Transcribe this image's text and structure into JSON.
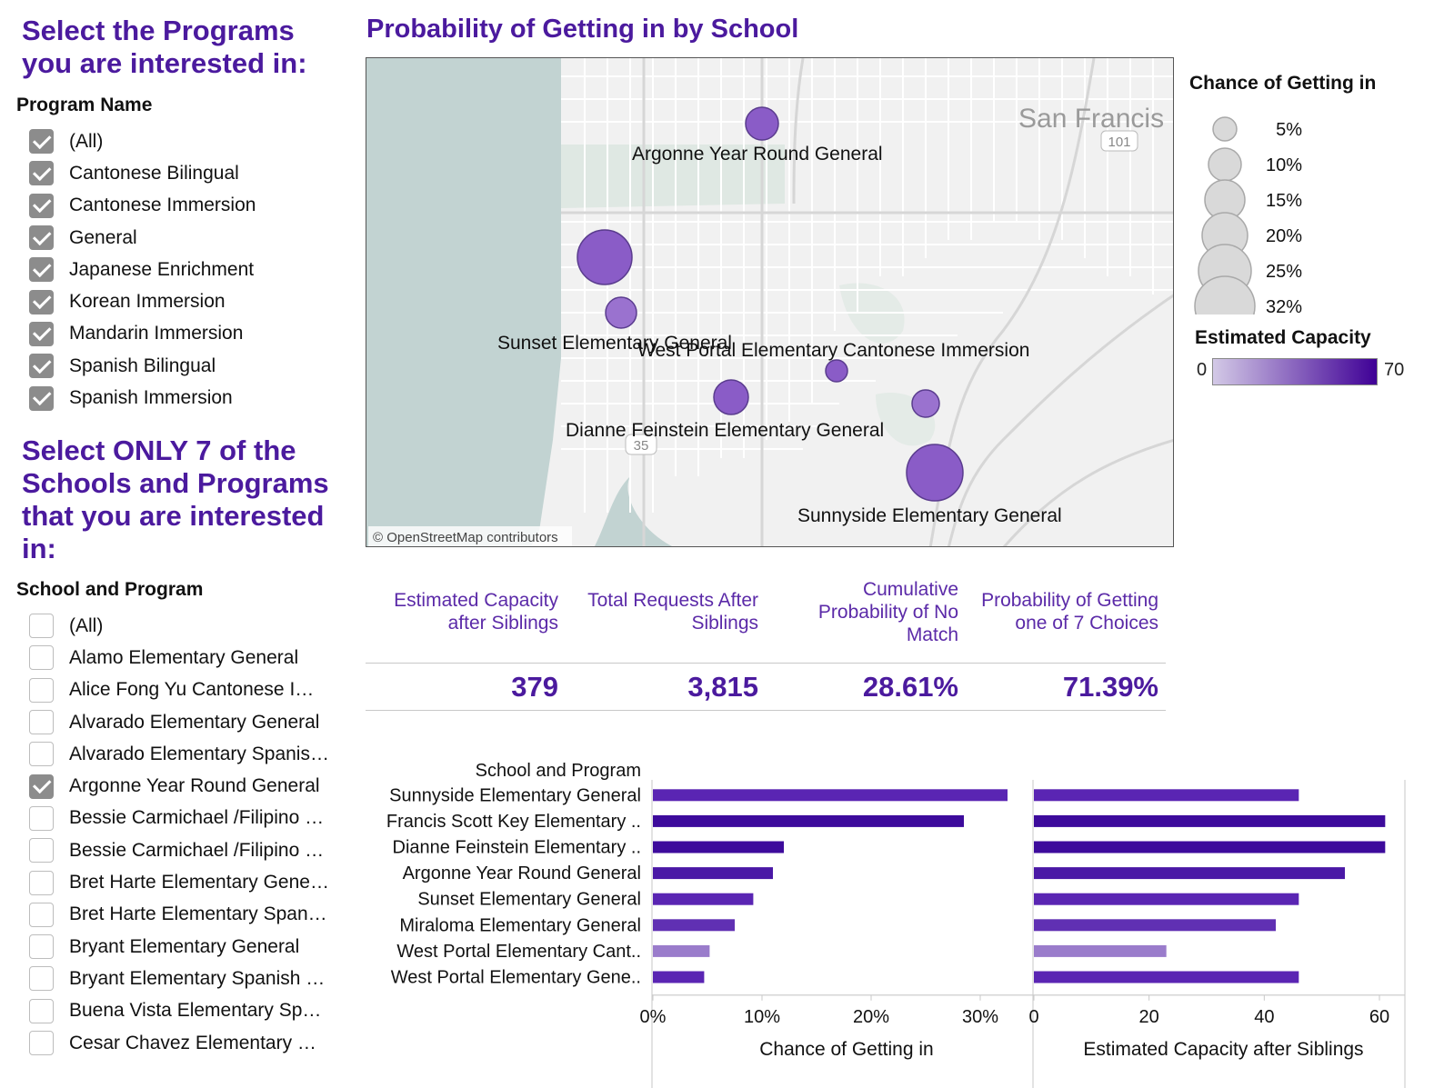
{
  "filters": {
    "programs_title": "Select the Programs you are interested in:",
    "program_field": "Program Name",
    "programs": [
      {
        "label": "(All)",
        "checked": true
      },
      {
        "label": "Cantonese Bilingual",
        "checked": true
      },
      {
        "label": "Cantonese Immersion",
        "checked": true
      },
      {
        "label": "General",
        "checked": true
      },
      {
        "label": "Japanese Enrichment",
        "checked": true
      },
      {
        "label": "Korean Immersion",
        "checked": true
      },
      {
        "label": "Mandarin Immersion",
        "checked": true
      },
      {
        "label": "Spanish Bilingual",
        "checked": true
      },
      {
        "label": "Spanish Immersion",
        "checked": true
      }
    ],
    "schools_title": "Select ONLY 7 of the Schools and Programs that you are interested in:",
    "school_field": "School and Program",
    "schools": [
      {
        "label": "(All)",
        "checked": false
      },
      {
        "label": "Alamo Elementary  General",
        "checked": false
      },
      {
        "label": "Alice Fong Yu  Cantonese I…",
        "checked": false
      },
      {
        "label": "Alvarado Elementary  General",
        "checked": false
      },
      {
        "label": "Alvarado Elementary  Spanis…",
        "checked": false
      },
      {
        "label": "Argonne Year Round  General",
        "checked": true
      },
      {
        "label": "Bessie Carmichael /Filipino …",
        "checked": false
      },
      {
        "label": "Bessie Carmichael /Filipino …",
        "checked": false
      },
      {
        "label": "Bret Harte Elementary  Gene…",
        "checked": false
      },
      {
        "label": "Bret Harte Elementary  Span…",
        "checked": false
      },
      {
        "label": "Bryant Elementary  General",
        "checked": false
      },
      {
        "label": "Bryant Elementary  Spanish …",
        "checked": false
      },
      {
        "label": "Buena Vista Elementary  Sp…",
        "checked": false
      },
      {
        "label": "Cesar Chavez Elementary  …",
        "checked": false
      }
    ]
  },
  "map": {
    "title": "Probability of Getting in by School",
    "city_label": "San Francis",
    "highway_101": "101",
    "highway_35": "35",
    "attribution": "© OpenStreetMap contributors",
    "labels": {
      "argonne": "Argonne Year Round  General",
      "sunset": "Sunset Elementary  General",
      "west_portal": "West Portal Elementary  Cantonese Immersion",
      "feinstein": "Dianne Feinstein Elementary  General",
      "sunnyside": "Sunnyside Elementary  General"
    },
    "colors": {
      "water": "#c2d3d2",
      "land": "#f1f1f1",
      "road": "#ffffff",
      "park": "#dfe8e3"
    }
  },
  "legend": {
    "size_title": "Chance of Getting in",
    "size_items": [
      "5%",
      "10%",
      "15%",
      "20%",
      "25%",
      "32%"
    ],
    "color_title": "Estimated Capacity",
    "color_min": "0",
    "color_max": "70",
    "gradient_start": "#d3c9e6",
    "gradient_end": "#3f0096"
  },
  "kpis": {
    "cap_head": [
      "Estimated Capacity",
      "after Siblings"
    ],
    "cap_value": "379",
    "req_head": [
      "Total Requests After",
      "Siblings"
    ],
    "req_value": "3,815",
    "nomatch_head": [
      "Cumulative",
      "Probability of No",
      "Match"
    ],
    "nomatch_value": "28.61%",
    "prob_head": [
      "Probability of Getting",
      "one of 7 Choices"
    ],
    "prob_value": "71.39%"
  },
  "chart_data": {
    "type": "bar",
    "row_header": "School and Program",
    "categories": [
      "Sunnyside Elementary  General",
      "Francis Scott Key Elementary ..",
      "Dianne Feinstein Elementary  ..",
      "Argonne Year Round  General",
      "Sunset Elementary  General",
      "Miraloma Elementary  General",
      "West Portal Elementary  Cant..",
      "West Portal Elementary  Gene.."
    ],
    "series": [
      {
        "name": "Chance of Getting in",
        "values": [
          32.5,
          28.5,
          12,
          11,
          9.2,
          7.5,
          5.2,
          4.7
        ],
        "ticks": [
          "0%",
          "10%",
          "20%",
          "30%"
        ],
        "xlim": [
          0,
          34
        ]
      },
      {
        "name": "Estimated Capacity  after Siblings",
        "values": [
          46,
          61,
          61,
          54,
          46,
          42,
          23,
          46
        ],
        "ticks": [
          "0",
          "20",
          "40",
          "60"
        ],
        "xlim": [
          0,
          63
        ]
      }
    ],
    "bar_colors": [
      "#5a25b3",
      "#3d0b9c",
      "#3d0b9c",
      "#4a18a6",
      "#5a25b3",
      "#6030b3",
      "#9a7ccb",
      "#5a25b3"
    ]
  }
}
